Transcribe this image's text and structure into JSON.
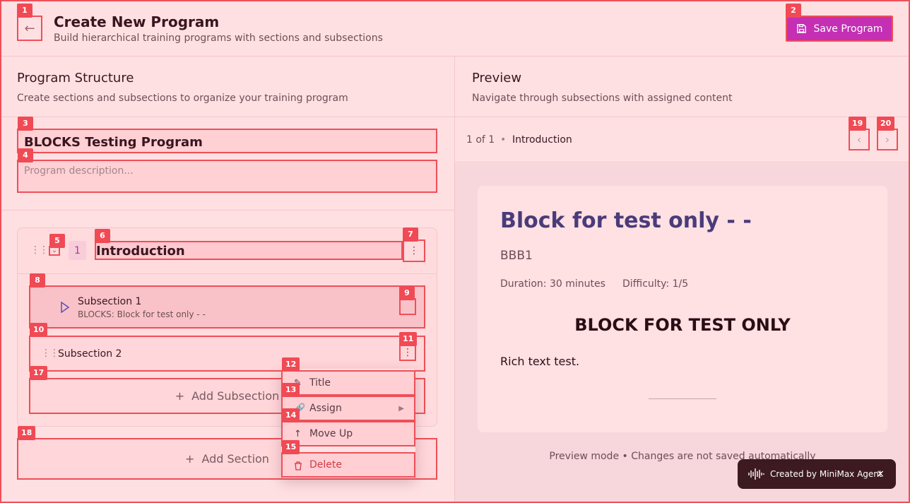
{
  "header": {
    "title": "Create New Program",
    "subtitle": "Build hierarchical training programs with sections and subsections",
    "back_icon": "arrow-left-icon",
    "save_label": "Save Program",
    "save_icon": "floppy-disk-icon"
  },
  "structure": {
    "title": "Program Structure",
    "subtitle": "Create sections and subsections to organize your training program",
    "program_title_value": "BLOCKS Testing Program",
    "program_description_placeholder": "Program description...",
    "section": {
      "number": "1",
      "title_value": "Introduction",
      "subsections": [
        {
          "title": "Subsection 1",
          "detail": "BLOCKS: Block for test only - -"
        },
        {
          "title": "Subsection 2"
        }
      ],
      "add_subsection_label": "Add Subsection"
    },
    "add_section_label": "Add Section"
  },
  "context_menu": {
    "items": [
      {
        "label": "Title",
        "icon": "pencil-icon"
      },
      {
        "label": "Assign",
        "icon": "link-icon"
      },
      {
        "label": "Move Up",
        "icon": "arrow-up-icon"
      },
      {
        "label": "Delete",
        "icon": "trash-icon"
      }
    ]
  },
  "preview": {
    "title": "Preview",
    "subtitle": "Navigate through subsections with assigned content",
    "position": "1 of 1",
    "separator": "•",
    "current": "Introduction",
    "block_title": "Block for test only - -",
    "block_code": "BBB1",
    "duration": "Duration: 30 minutes",
    "difficulty": "Difficulty: 1/5",
    "content_heading": "BLOCK FOR TEST ONLY",
    "content_text": "Rich text test.",
    "footnote": "Preview mode • Changes are not saved automatically"
  },
  "toast": {
    "label": "Created by MiniMax Agent",
    "close": "×"
  },
  "badges": [
    "1",
    "2",
    "3",
    "4",
    "5",
    "6",
    "7",
    "8",
    "9",
    "10",
    "11",
    "12",
    "13",
    "14",
    "15",
    "17",
    "18",
    "19",
    "20"
  ],
  "colors": {
    "accent": "#c42fb4",
    "annotation": "#ef4f58",
    "preview_heading": "#4a3b7a",
    "delete": "#d23a48"
  }
}
